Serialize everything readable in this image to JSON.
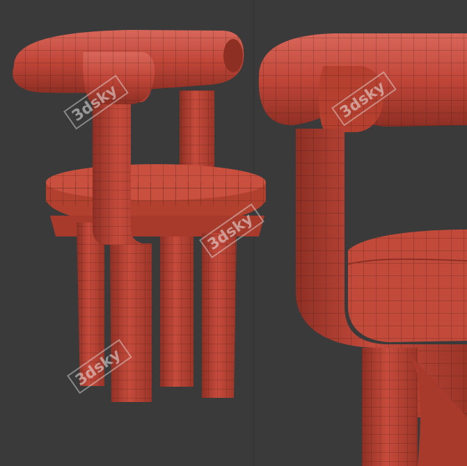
{
  "scene": {
    "description_free": true,
    "background_color": "#3a3a3a",
    "model_color": "#c64b3c",
    "model_shadow": "#8e2f24",
    "model_highlight": "#d8675a",
    "wire_color": "#2a120e"
  },
  "watermarks": [
    {
      "text": "3dsky"
    },
    {
      "text": "3dsky"
    },
    {
      "text": "3dsky"
    },
    {
      "text": "3dsky"
    }
  ]
}
